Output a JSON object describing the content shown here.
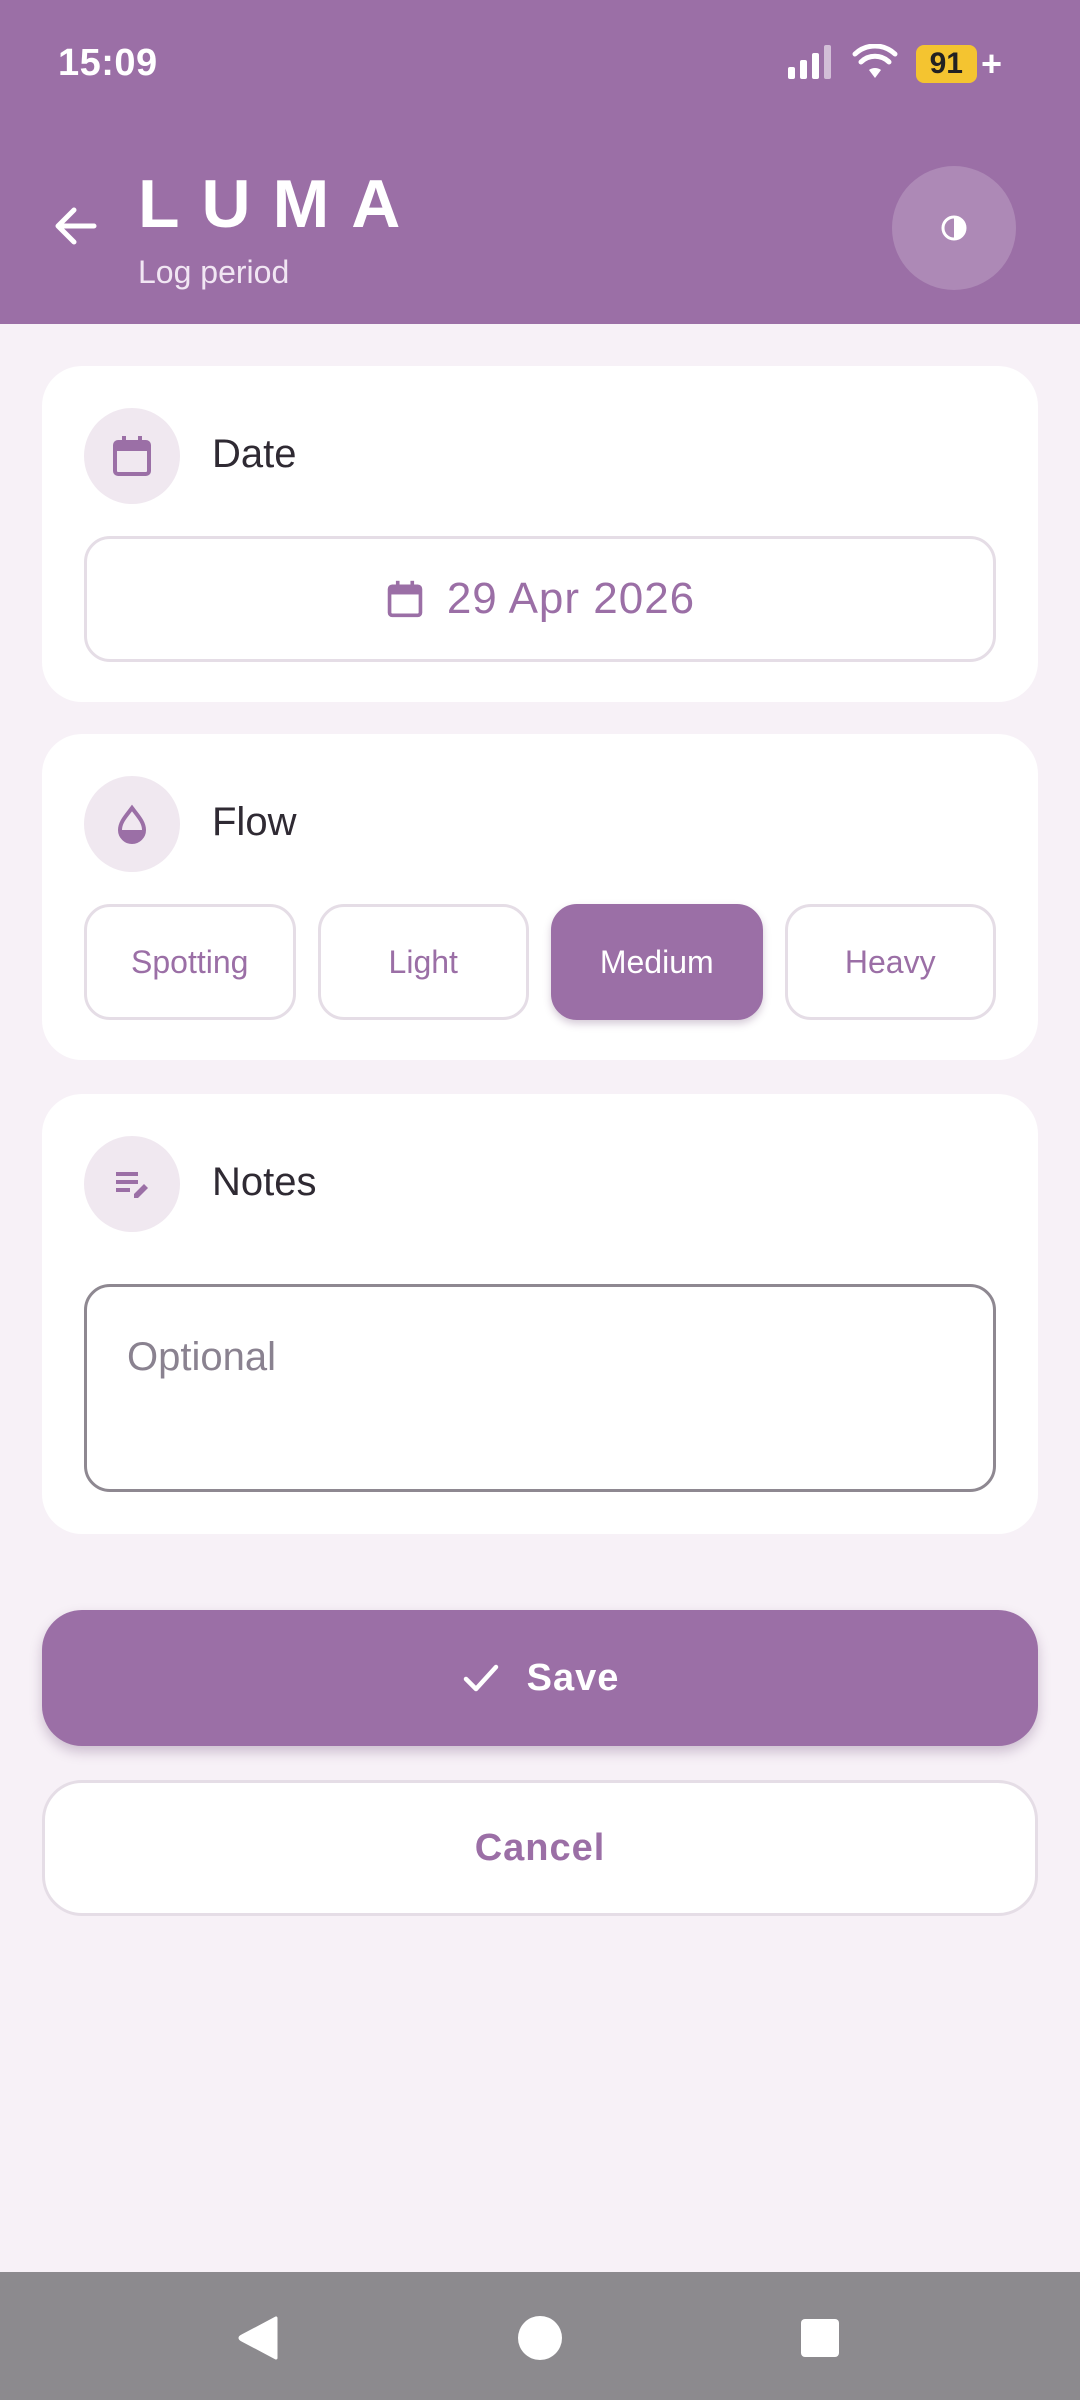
{
  "status_bar": {
    "time": "15:09",
    "battery": "91",
    "battery_suffix": "+",
    "icons": [
      "signal-icon",
      "wifi-icon",
      "battery-icon"
    ]
  },
  "app_bar": {
    "title": "LUMA",
    "subtitle": "Log period",
    "icons": [
      "back-arrow-icon",
      "contrast-icon"
    ]
  },
  "date_card": {
    "title": "Date",
    "value": "29 Apr 2026",
    "icon": "calendar-icon"
  },
  "flow_card": {
    "title": "Flow",
    "icon": "drop-icon",
    "options": [
      "Spotting",
      "Light",
      "Medium",
      "Heavy"
    ],
    "selected": "Medium"
  },
  "notes_card": {
    "title": "Notes",
    "icon": "edit-notes-icon",
    "placeholder": "Optional"
  },
  "actions": {
    "save_label": "Save",
    "cancel_label": "Cancel"
  },
  "colors": {
    "primary": "#9b6fa6",
    "background": "#f7f1f7",
    "battery": "#f4c430"
  }
}
